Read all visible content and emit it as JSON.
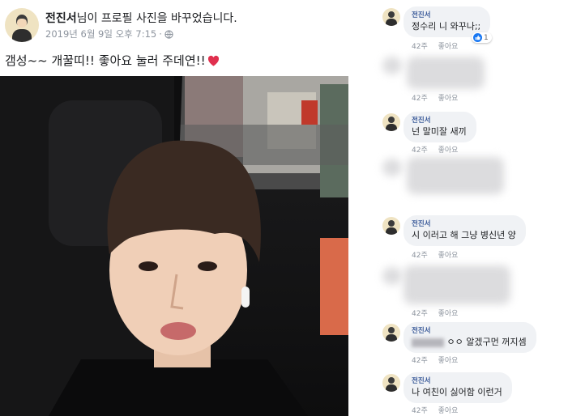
{
  "post": {
    "author": "전진서",
    "action": "님이 프로필 사진을 바꾸었습니다.",
    "date": "2019년 6월 9일 오후 7:15",
    "caption": "갬성~~ 개꿀띠!! 좋아요 눌러 주데연!!",
    "photo_icon": "profile-photo"
  },
  "comments": [
    {
      "name": "전진서",
      "text": "정수리 니 와꾸나;;",
      "time": "42주",
      "like": "좋아요",
      "reaction_count": "1"
    },
    {
      "name": "",
      "text": "",
      "time": "42주",
      "like": "좋아요"
    },
    {
      "name": "전진서",
      "text": "넌 말미잘 새끼",
      "time": "42주",
      "like": "좋아요"
    },
    {
      "name": "",
      "text": "",
      "time": "",
      "like": ""
    },
    {
      "name": "전진서",
      "text": "시 이러고 해 그냥 병신년 양",
      "time": "42주",
      "like": "좋아요"
    },
    {
      "name": "",
      "text": "",
      "time": "42주",
      "like": "좋아요"
    },
    {
      "name": "전진서",
      "text": "ㅇㅇ 알겠구먼 꺼지셈",
      "time": "42주",
      "like": "좋아요"
    },
    {
      "name": "전진서",
      "text": "나 여친이 싫어함 이런거",
      "time": "42주",
      "like": "좋아요"
    }
  ],
  "colors": {
    "name_link": "#385898",
    "bubble_bg": "#f0f2f5",
    "meta_gray": "#8d949e",
    "heart": "#e0304e",
    "like_blue": "#1877f2"
  }
}
